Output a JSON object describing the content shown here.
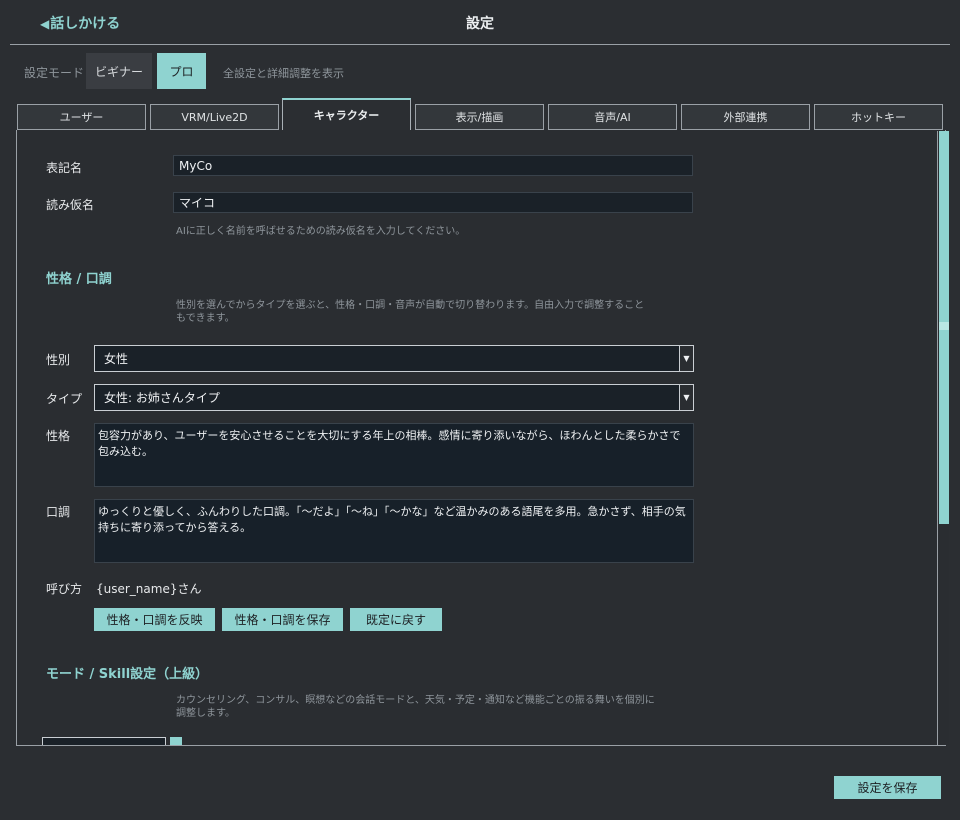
{
  "header": {
    "back_label": "話しかける",
    "title": "設定"
  },
  "mode": {
    "label": "設定モード",
    "options": [
      "ビギナー",
      "プロ"
    ],
    "selected": "プロ",
    "description": "全設定と詳細調整を表示"
  },
  "tabs": [
    {
      "label": "ユーザー"
    },
    {
      "label": "VRM/Live2D"
    },
    {
      "label": "キャラクター",
      "active": true
    },
    {
      "label": "表示/描画"
    },
    {
      "label": "音声/AI"
    },
    {
      "label": "外部連携"
    },
    {
      "label": "ホットキー"
    }
  ],
  "character": {
    "display_name_label": "表記名",
    "display_name_value": "MyCo",
    "reading_label": "読み仮名",
    "reading_value": "マイコ",
    "reading_hint": "AIに正しく名前を呼ばせるための読み仮名を入力してください。"
  },
  "personality": {
    "section_title": "性格 / 口調",
    "hint_line1": "性別を選んでからタイプを選ぶと、性格・口調・音声が自動で切り替わります。自由入力で調整すること",
    "hint_line2": "もできます。",
    "gender_label": "性別",
    "gender_value": "女性",
    "type_label": "タイプ",
    "type_value": "女性: お姉さんタイプ",
    "personality_label": "性格",
    "personality_value": "包容力があり、ユーザーを安心させることを大切にする年上の相棒。感情に寄り添いながら、ほわんとした柔らかさで包み込む。",
    "tone_label": "口調",
    "tone_value": "ゆっくりと優しく、ふんわりした口調。「〜だよ」「〜ね」「〜かな」など温かみのある語尾を多用。急かさず、相手の気持ちに寄り添ってから答える。",
    "call_label": "呼び方",
    "call_value": "{user_name}さん",
    "buttons": {
      "apply": "性格・口調を反映",
      "save": "性格・口調を保存",
      "reset": "既定に戻す"
    }
  },
  "mode_skill": {
    "section_title": "モード / Skill設定（上級）",
    "hint_line1": "カウンセリング、コンサル、瞑想などの会話モードと、天気・予定・通知など機能ごとの振る舞いを個別に",
    "hint_line2": "調整します。"
  },
  "footer": {
    "save_label": "設定を保存"
  },
  "colors": {
    "accent": "#8fd3d0",
    "background": "#2b2e32",
    "field": "#1a2128"
  }
}
